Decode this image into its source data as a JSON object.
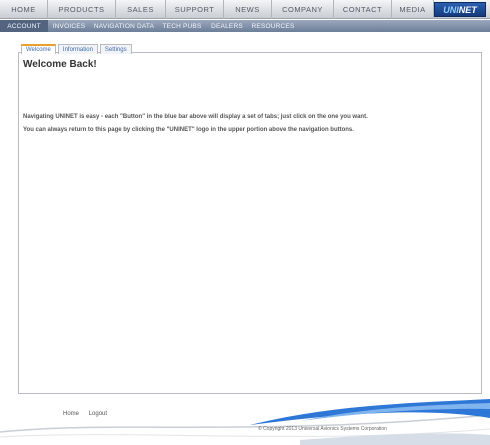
{
  "topnav": {
    "items": [
      "HOME",
      "PRODUCTS",
      "SALES",
      "SUPPORT",
      "NEWS",
      "COMPANY",
      "CONTACT",
      "MEDIA"
    ],
    "logo": {
      "prefix": "UNI",
      "suffix": "NET"
    }
  },
  "subnav": {
    "items": [
      "ACCOUNT",
      "INVOICES",
      "NAVIGATION DATA",
      "TECH PUBS",
      "DEALERS",
      "RESOURCES"
    ],
    "active": "ACCOUNT"
  },
  "tabs": [
    "Welcome",
    "Information",
    "Settings"
  ],
  "main": {
    "heading": "Welcome Back!",
    "paragraph1": "Navigating UNINET is easy - each \"Button\" in the blue bar above will display a set of tabs; just click on the one you want.",
    "paragraph2": "You can always return to this page by clicking the \"UNINET\" logo in the upper portion above the navigation buttons."
  },
  "footer": {
    "links": [
      "Home",
      "Logout"
    ],
    "copyright": "© Copyright 2013 Universal Avionics Systems Corporation"
  },
  "colors": {
    "subnav_bg": "#7d8ca4",
    "logo_bg": "#1e4b94",
    "tab_accent": "#e9a12e",
    "swoosh_blue": "#2f77d6"
  }
}
